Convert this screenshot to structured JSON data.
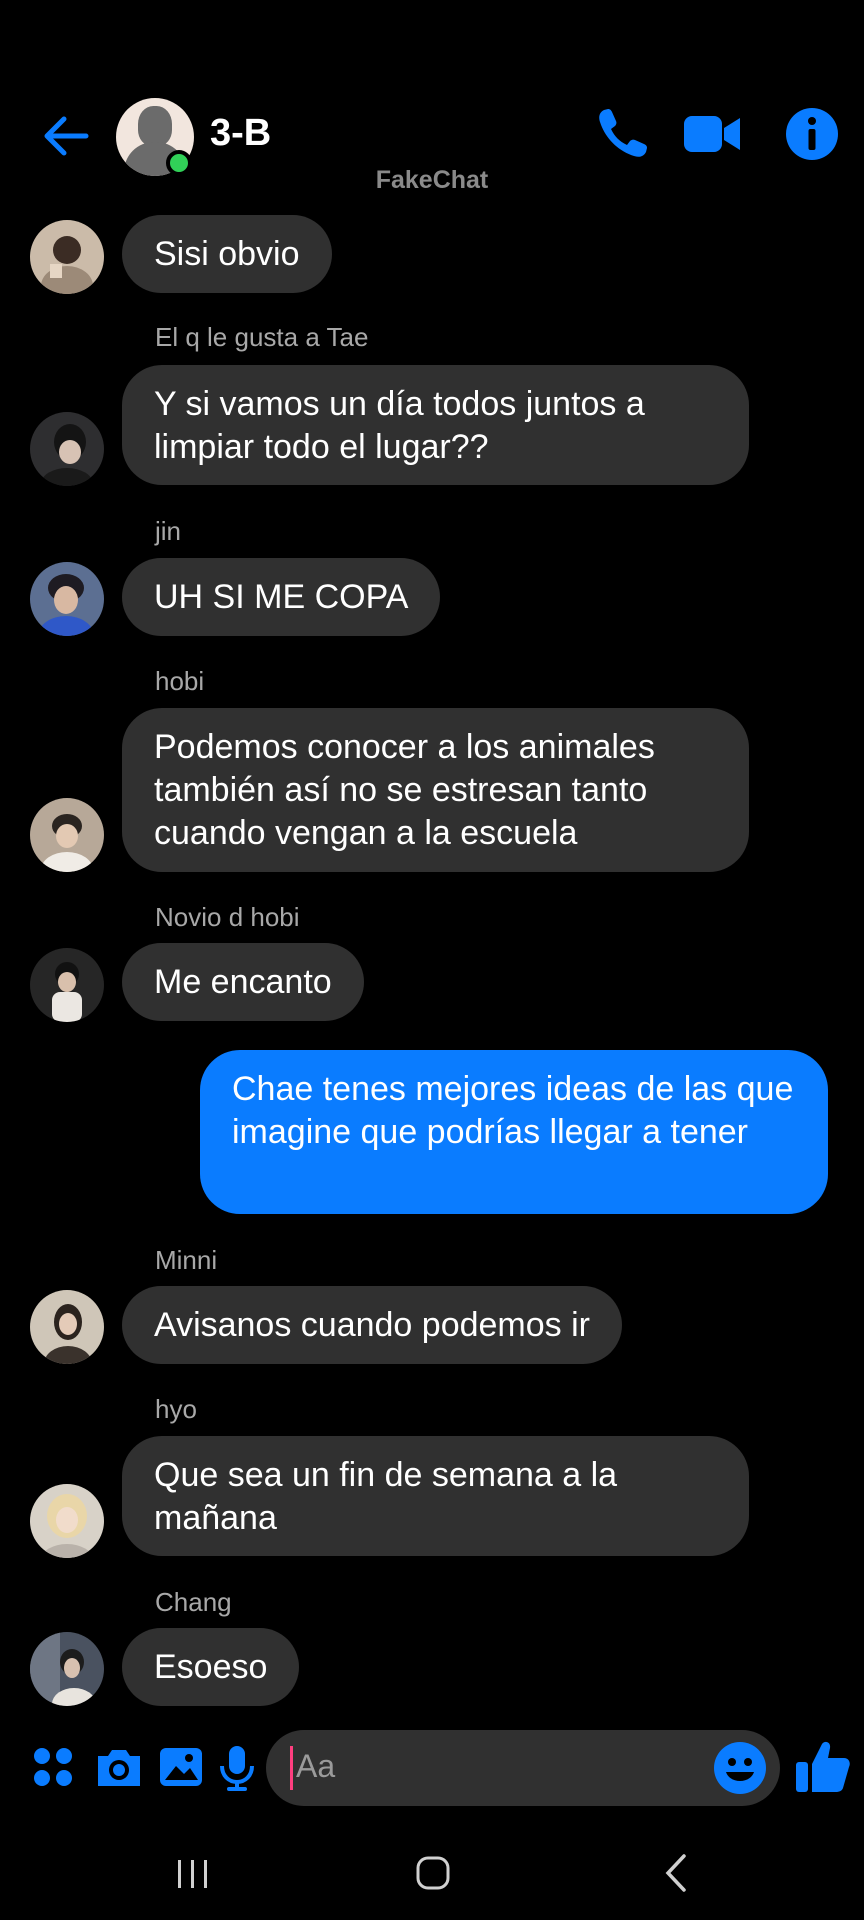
{
  "header": {
    "title": "3-B",
    "watermark": "FakeChat"
  },
  "messages": [
    {
      "sender": "",
      "text": "Sisi obvio",
      "from_me": false
    },
    {
      "sender": "El q le gusta a Tae",
      "text": "Y si vamos un día todos juntos a limpiar todo el lugar??",
      "from_me": false
    },
    {
      "sender": "jin",
      "text": "UH SI ME COPA",
      "from_me": false
    },
    {
      "sender": "hobi",
      "text": "Podemos conocer a los animales también así no se estresan tanto cuando vengan a la escuela",
      "from_me": false
    },
    {
      "sender": "Novio d hobi",
      "text": "Me encanto",
      "from_me": false
    },
    {
      "sender": "",
      "text": "Chae tenes mejores ideas de las que imagine que podrías llegar a tener",
      "from_me": true
    },
    {
      "sender": "Minni",
      "text": "Avisanos cuando podemos ir",
      "from_me": false
    },
    {
      "sender": "hyo",
      "text": "Que sea un fin de semana a la mañana",
      "from_me": false
    },
    {
      "sender": "Chang",
      "text": "Esoeso",
      "from_me": false
    }
  ],
  "composer": {
    "placeholder": "Aa"
  },
  "colors": {
    "accent": "#0a7cff",
    "bubble_other": "#303030",
    "online": "#31d158",
    "background": "#000000"
  },
  "icons": [
    "back-arrow-icon",
    "phone-icon",
    "video-icon",
    "info-icon",
    "apps-icon",
    "camera-icon",
    "gallery-icon",
    "mic-icon",
    "emoji-icon",
    "thumbs-up-icon",
    "recents-icon",
    "home-icon",
    "back-icon"
  ]
}
